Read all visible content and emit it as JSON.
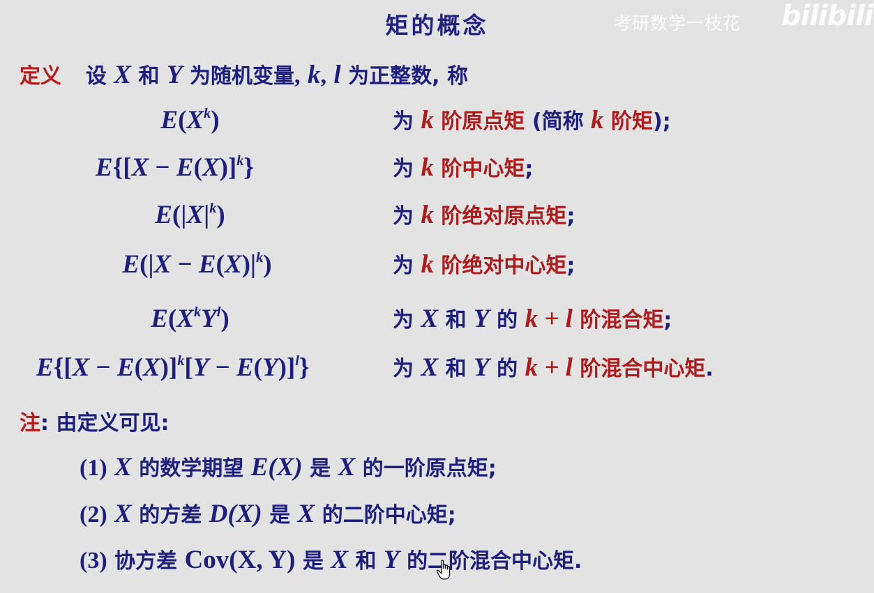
{
  "slide": {
    "title": "矩的概念",
    "watermark": "考研数学一枝花",
    "watermark_logo": "bilibili"
  },
  "definition": {
    "label": "定义",
    "text_1": "设",
    "var_x": "X",
    "text_2": "和",
    "var_y": "Y",
    "text_3": "为随机变量",
    "comma_1": ",",
    "var_k": "k",
    "comma_2": ",",
    "var_l": "l",
    "text_4": "为正整数",
    "text_5": ", 称"
  },
  "moments": [
    {
      "formula": "E(X^k)",
      "desc_a": "为",
      "desc_var": "k",
      "desc_b": "阶原点矩",
      "desc_c": "(简称",
      "desc_var2": "k",
      "desc_d": "阶矩",
      "desc_e": ");"
    },
    {
      "formula": "E{[X−E(X)]^k}",
      "desc_a": "为",
      "desc_var": "k",
      "desc_b": "阶中心矩",
      "desc_e": ";"
    },
    {
      "formula": "E(|X|^k)",
      "desc_a": "为",
      "desc_var": "k",
      "desc_b": "阶绝对原点矩",
      "desc_e": ";"
    },
    {
      "formula": "E(|X−E(X)|^k)",
      "desc_a": "为",
      "desc_var": "k",
      "desc_b": "阶绝对中心矩",
      "desc_e": ";"
    },
    {
      "formula": "E(X^kY^l)",
      "desc_a": "为",
      "desc_x": "X",
      "desc_and": "和",
      "desc_y": "Y",
      "desc_of": "的",
      "desc_kl": "k + l",
      "desc_b": "阶混合矩",
      "desc_e": ";"
    },
    {
      "formula": "E{[X−E(X)]^k[Y−E(Y)]^l}",
      "desc_a": "为",
      "desc_x": "X",
      "desc_and": "和",
      "desc_y": "Y",
      "desc_of": "的",
      "desc_kl": "k + l",
      "desc_b": "阶混合中心矩",
      "desc_e": "."
    }
  ],
  "notes": {
    "label": "注",
    "intro": ": 由定义可见:",
    "items": [
      {
        "num": "(1)",
        "var": "X",
        "t1": "的数学期望",
        "expr": "E(X)",
        "t2": "是",
        "var2": "X",
        "t3": "的一阶原点矩;"
      },
      {
        "num": "(2)",
        "var": "X",
        "t1": "的方差",
        "expr": "D(X)",
        "t2": "是",
        "var2": "X",
        "t3": "的二阶中心矩;"
      },
      {
        "num": "(3)",
        "t1": "协方差",
        "expr": "Cov(X, Y)",
        "t2": "是",
        "var2": "X",
        "and": "和",
        "var3": "Y",
        "t3": "的二阶混合中心矩."
      }
    ]
  },
  "colors": {
    "background": "#e3e3e3",
    "text_blue": "#1d1f7e",
    "accent_red": "#b01a1a"
  }
}
